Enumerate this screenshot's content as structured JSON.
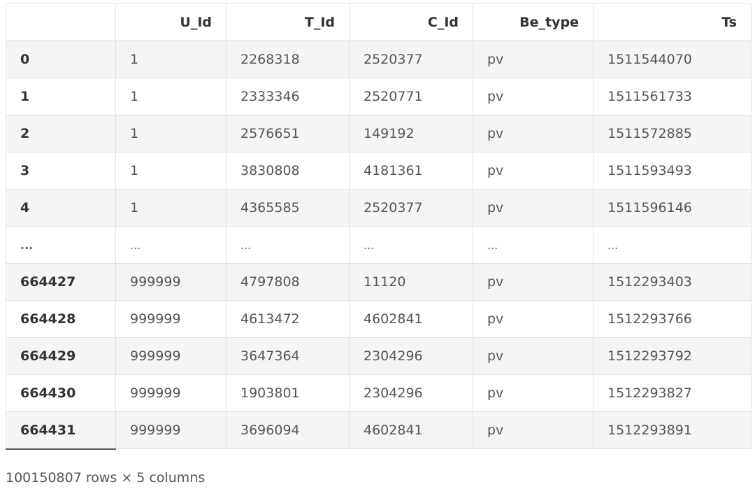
{
  "table": {
    "columns": [
      "",
      "U_Id",
      "T_Id",
      "C_Id",
      "Be_type",
      "Ts"
    ],
    "rows": [
      [
        "0",
        "1",
        "2268318",
        "2520377",
        "pv",
        "1511544070"
      ],
      [
        "1",
        "1",
        "2333346",
        "2520771",
        "pv",
        "1511561733"
      ],
      [
        "2",
        "1",
        "2576651",
        "149192",
        "pv",
        "1511572885"
      ],
      [
        "3",
        "1",
        "3830808",
        "4181361",
        "pv",
        "1511593493"
      ],
      [
        "4",
        "1",
        "4365585",
        "2520377",
        "pv",
        "1511596146"
      ],
      [
        "...",
        "...",
        "...",
        "...",
        "...",
        "..."
      ],
      [
        "664427",
        "999999",
        "4797808",
        "11120",
        "pv",
        "1512293403"
      ],
      [
        "664428",
        "999999",
        "4613472",
        "4602841",
        "pv",
        "1512293766"
      ],
      [
        "664429",
        "999999",
        "3647364",
        "2304296",
        "pv",
        "1512293792"
      ],
      [
        "664430",
        "999999",
        "1903801",
        "2304296",
        "pv",
        "1512293827"
      ],
      [
        "664431",
        "999999",
        "3696094",
        "4602841",
        "pv",
        "1512293891"
      ]
    ]
  },
  "shape_note": "100150807 rows × 5 columns"
}
